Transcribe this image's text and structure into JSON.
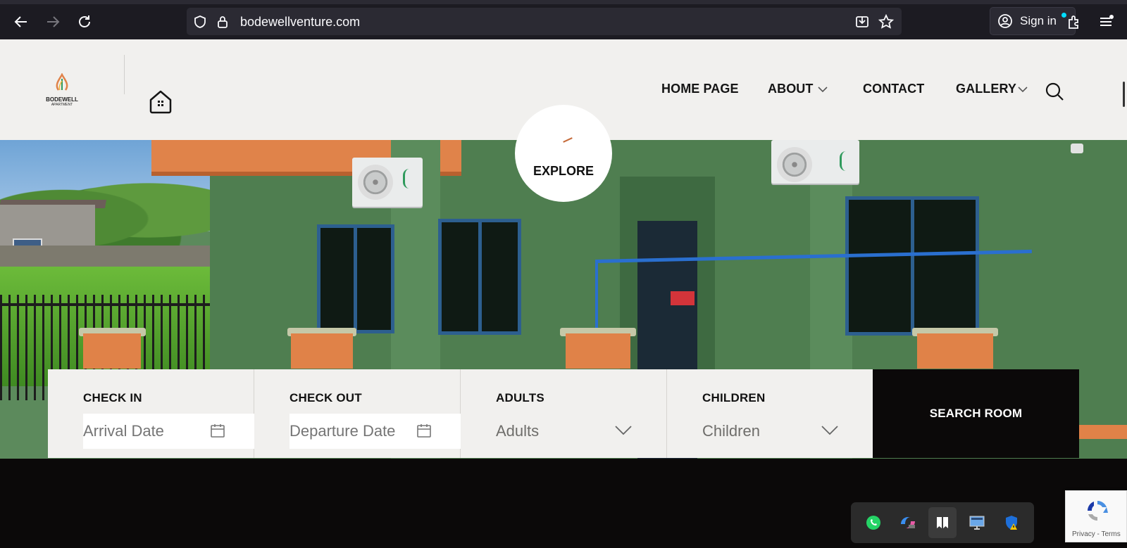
{
  "browser": {
    "url": "bodewellventure.com",
    "sign_in_label": "Sign in"
  },
  "site": {
    "logo": {
      "brand": "BODEWELL",
      "sub": "APARTMENT"
    },
    "nav": [
      {
        "label": "HOME PAGE",
        "has_dropdown": false
      },
      {
        "label": "ABOUT",
        "has_dropdown": true
      },
      {
        "label": "CONTACT",
        "has_dropdown": false
      },
      {
        "label": "GALLERY",
        "has_dropdown": true
      }
    ]
  },
  "hero": {
    "explore_label": "EXPLORE"
  },
  "booking": {
    "check_in": {
      "label": "CHECK IN",
      "placeholder": "Arrival Date"
    },
    "check_out": {
      "label": "CHECK OUT",
      "placeholder": "Departure Date"
    },
    "adults": {
      "label": "ADULTS",
      "value": "Adults"
    },
    "children": {
      "label": "CHILDREN",
      "value": "Children"
    },
    "search_label": "SEARCH ROOM"
  },
  "taskbar": {
    "icons": [
      "whatsapp-icon",
      "copilot-icon",
      "app-icon",
      "desktop-icon",
      "security-icon"
    ]
  },
  "recaptcha": {
    "footer": "Privacy - Terms"
  },
  "colors": {
    "accent_orange": "#e0834a",
    "header_bg": "#f1f0ee",
    "dark": "#0b0909"
  }
}
